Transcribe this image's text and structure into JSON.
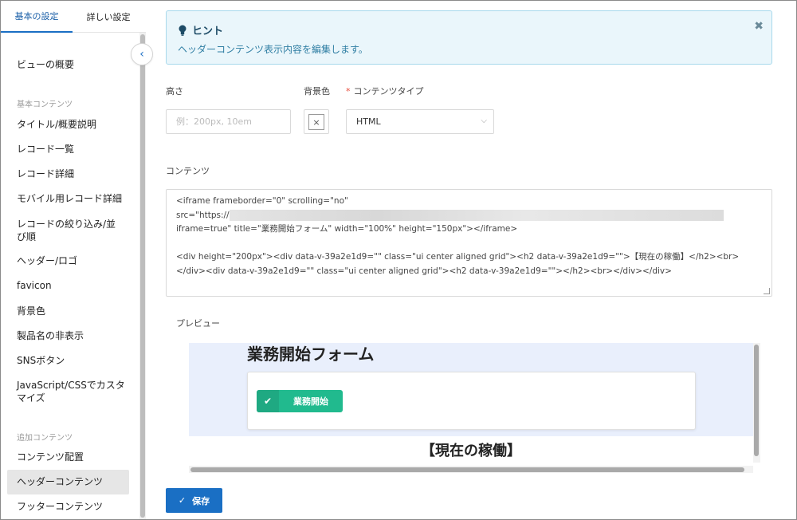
{
  "sidebar": {
    "tabs": [
      {
        "label": "基本の設定",
        "active": true
      },
      {
        "label": "詳しい設定",
        "active": false
      }
    ],
    "collapse_icon": "chevron-left-icon",
    "items": [
      {
        "label": "ビューの概要"
      },
      {
        "group": "基本コンテンツ"
      },
      {
        "label": "タイトル/概要説明"
      },
      {
        "label": "レコード一覧"
      },
      {
        "label": "レコード詳細"
      },
      {
        "label": "モバイル用レコード詳細"
      },
      {
        "label": "レコードの絞り込み/並び順"
      },
      {
        "label": "ヘッダー/ロゴ"
      },
      {
        "label": "favicon"
      },
      {
        "label": "背景色"
      },
      {
        "label": "製品名の非表示"
      },
      {
        "label": "SNSボタン"
      },
      {
        "label": "JavaScript/CSSでカスタマイズ"
      },
      {
        "group": "追加コンテンツ"
      },
      {
        "label": "コンテンツ配置"
      },
      {
        "label": "ヘッダーコンテンツ",
        "selected": true
      },
      {
        "label": "フッターコンテンツ"
      }
    ]
  },
  "hint": {
    "icon": "lightbulb-icon",
    "title": "ヒント",
    "body": "ヘッダーコンテンツ表示内容を編集します。",
    "close_icon": "close-icon"
  },
  "form": {
    "height_label": "高さ",
    "height_placeholder": "例：200px, 10em",
    "bgcolor_label": "背景色",
    "bgcolor_clear": "×",
    "content_type_required": "*",
    "content_type_label": "コンテンツタイプ",
    "content_type_value": "HTML",
    "content_label": "コンテンツ",
    "content_lines": [
      "<iframe frameborder=\"0\" scrolling=\"no\"",
      "src=\"https://",
      "iframe=true\" title=\"業務開始フォーム\"  width=\"100%\" height=\"150px\"></iframe>",
      "",
      "<div height=\"200px\"><div data-v-39a2e1d9=\"\" class=\"ui center aligned grid\"><h2 data-v-39a2e1d9=\"\">【現在の稼働】</h2><br>",
      "</div><div data-v-39a2e1d9=\"\" class=\"ui center aligned grid\"><h2 data-v-39a2e1d9=\"\"></h2><br></div></div>"
    ],
    "preview_label": "プレビュー"
  },
  "preview": {
    "title": "業務開始フォーム",
    "button_label": "業務開始",
    "button_icon": "check-icon",
    "subtitle": "【現在の稼働】",
    "colors": {
      "bg": "#e9effc",
      "button": "#21ba8e"
    }
  },
  "save": {
    "label": "保存",
    "icon": "check-icon"
  },
  "colors": {
    "accent": "#1a6fc4",
    "hint_bg": "#eaf6fb"
  }
}
